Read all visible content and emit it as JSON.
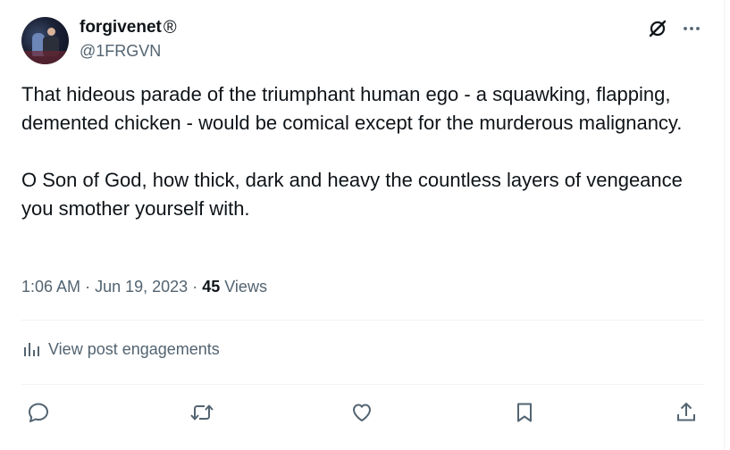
{
  "author": {
    "display_name": "forgivenet",
    "registered_mark": "®",
    "handle": "@1FRGVN"
  },
  "post": {
    "text": "That hideous parade of the triumphant human ego - a squawking, flapping, demented chicken - would be comical except for the murderous malignancy.\n\nO Son of God, how thick, dark and heavy the countless layers of vengeance you smother yourself with.",
    "time": "1:06 AM",
    "separator": "·",
    "date": "Jun 19, 2023",
    "views_count": "45",
    "views_label": "Views"
  },
  "engagements_label": "View post engagements",
  "icons": {
    "grok": "grok-icon",
    "more": "more-icon",
    "analytics": "analytics-icon",
    "reply": "reply-icon",
    "retweet": "retweet-icon",
    "like": "heart-icon",
    "bookmark": "bookmark-icon",
    "share": "share-icon"
  },
  "colors": {
    "text": "#0f1419",
    "secondary": "#536471",
    "divider": "#eff3f4"
  }
}
